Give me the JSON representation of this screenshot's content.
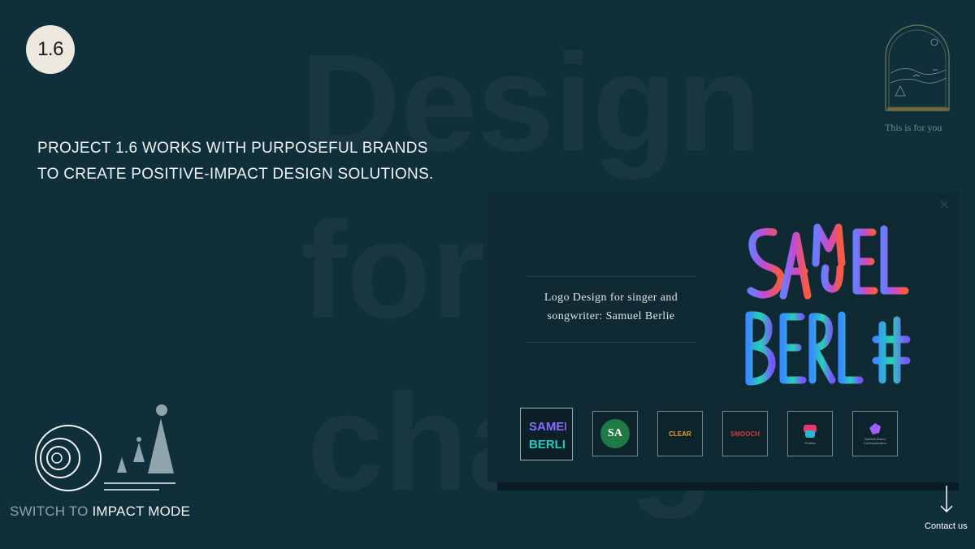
{
  "background_words": [
    "Design",
    "for",
    "change."
  ],
  "logo": {
    "text": "1.6"
  },
  "tagline": {
    "line1": "PROJECT 1.6 WORKS WITH PURPOSEFUL BRANDS",
    "line2": "TO CREATE POSITIVE-IMPACT DESIGN SOLUTIONS."
  },
  "arch_badge": {
    "label": "This is for you",
    "icon": "arch-landscape-icon"
  },
  "modal": {
    "close_icon": "close-icon",
    "description_line1": "Logo Design for singer and",
    "description_line2": "songwriter: Samuel Berlie",
    "hero_logo": {
      "line1": "SAMUEL",
      "line2": "BERLIE"
    },
    "thumbnails": [
      {
        "name": "samuel-berlie",
        "text": "SAMUEL BERLIE",
        "active": true
      },
      {
        "name": "sa",
        "text": "SA"
      },
      {
        "name": "clear",
        "text": "CLEAR"
      },
      {
        "name": "smooch",
        "text": "SMOOCH"
      },
      {
        "name": "profiles",
        "text": "Profiles"
      },
      {
        "name": "daniela-brand",
        "text": "Daniela Brand Communication"
      }
    ]
  },
  "impact_mode": {
    "prefix": "SWITCH TO",
    "highlight": "IMPACT MODE"
  },
  "contact": {
    "label": "Contact us",
    "icon": "arrow-down-icon"
  },
  "colors": {
    "background": "#0f2f3b",
    "modal": "#102a33",
    "logo_badge": "#ede9df",
    "accent_dim": "#8da1a8"
  }
}
